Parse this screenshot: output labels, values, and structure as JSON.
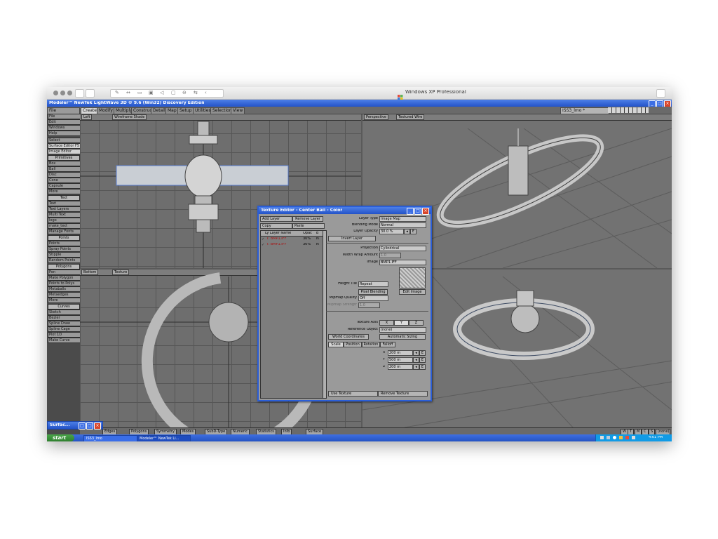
{
  "mac": {
    "title": "Windows XP Professional"
  },
  "app": {
    "title": "Modeler™ NewTek LightWave 3D © 9.6  (Win32) Discovery Edition",
    "object_name": "ISS3_lmo *",
    "tabs": [
      "Create",
      "Modify",
      "Multiply",
      "Construct",
      "Detail",
      "Map",
      "Setup",
      "Utilities",
      "Selection",
      "View"
    ],
    "sidebar_top": [
      "File",
      "Edit",
      "Windows",
      "Help"
    ],
    "select_label": "Select",
    "surface_editor": "Surface Editor",
    "surface_editor_key": "F5",
    "image_editor": "Image Editor",
    "primitives_header": "Primitives",
    "primitives": [
      "Box",
      "Ball",
      "Disc",
      "Cone",
      "Capsule",
      "More"
    ],
    "text_header": "Text",
    "text_items": [
      "Text",
      "Text Layers",
      "Multi Text",
      "logo",
      "make_text",
      "Manage Fonts"
    ],
    "points_header": "Points",
    "points_items": [
      "Points",
      "Spray Points",
      "Stipple",
      "Random Points"
    ],
    "polygons_header": "Polygons",
    "polygons_items": [
      "Pen",
      "Make Polygon",
      "Points to Polys",
      "Metaballs",
      "Metaedges",
      "More"
    ],
    "curves_header": "Curves",
    "curves_items": [
      "Sketch",
      "Bezier",
      "Spline Draw",
      "Spline Cage",
      "Plot 1D",
      "Make Curve"
    ]
  },
  "viewports": {
    "tl": {
      "view": "Left",
      "mode": "Wireframe Shade"
    },
    "tr": {
      "view": "Perspective",
      "mode": "Textured Wire"
    },
    "bl": {
      "view": "Bottom",
      "mode": "Texture"
    }
  },
  "texture_editor": {
    "title": "Texture Editor - Center Ball - Color",
    "add_layer": "Add Layer",
    "remove_layer": "Remove Layer",
    "copy": "Copy",
    "paste": "Paste",
    "col_name": "Ly Layer Name",
    "col_opac": "Opac",
    "col_b": "B",
    "layers": [
      {
        "name": "I: BMP1.IFF",
        "opac": "30%",
        "b": "N"
      },
      {
        "name": "I: BMP1.IFF",
        "opac": "30%",
        "b": "N"
      }
    ],
    "layer_type_label": "Layer Type",
    "layer_type": "Image Map",
    "blending_label": "Blending Mode",
    "blending": "Normal",
    "opacity_label": "Layer Opacity",
    "opacity": "30.0 %",
    "invert_layer": "Invert Layer",
    "projection_label": "Projection",
    "projection": "Cylindrical",
    "width_wrap_label": "Width Wrap Amount",
    "width_wrap": "1.0",
    "image_label": "Image",
    "image": "BMP1.IFF",
    "height_tile_label": "Height Tile",
    "height_tile": "Repeat",
    "pixel_blending": "Pixel Blending",
    "edit_image": "Edit Image",
    "mipmap_label": "Mipmap Quality",
    "mipmap": "Off",
    "mipmap_strength_label": "Mipmap Strength",
    "mipmap_strength": "1.0",
    "texture_axis_label": "Texture Axis",
    "axes": [
      "X",
      "Y",
      "Z"
    ],
    "reference_label": "Reference Object",
    "reference": "(none)",
    "world_coords": "World Coordinates",
    "auto_sizing": "Automatic Sizing",
    "subtabs": [
      "Scale",
      "Position",
      "Rotation",
      "Falloff"
    ],
    "xyz": [
      "X",
      "Y",
      "Z"
    ],
    "scale_values": [
      "200 m",
      "500 m",
      "200 m"
    ],
    "use_texture": "Use Texture",
    "remove_texture": "Remove Texture"
  },
  "statusbar": {
    "items": [
      "Edges",
      "Polygons",
      "Symmetry",
      "Modes",
      "SubD-Type",
      "Numeric",
      "Statistics",
      "Info",
      "Surface"
    ],
    "wmcs": [
      "W",
      "T",
      "M",
      "C",
      "S"
    ],
    "none": "(none)"
  },
  "surf_mini": "Surfac...",
  "taskbar": {
    "start": "start",
    "tasks": [
      "ISS3_lmo",
      "Modeler™ NewTek Li..."
    ],
    "clock": "4:01 PM"
  },
  "colors": {
    "xp_blue": "#2353c8",
    "start_green": "#2e7f2e",
    "viewport_gray": "#6e6e6e"
  }
}
